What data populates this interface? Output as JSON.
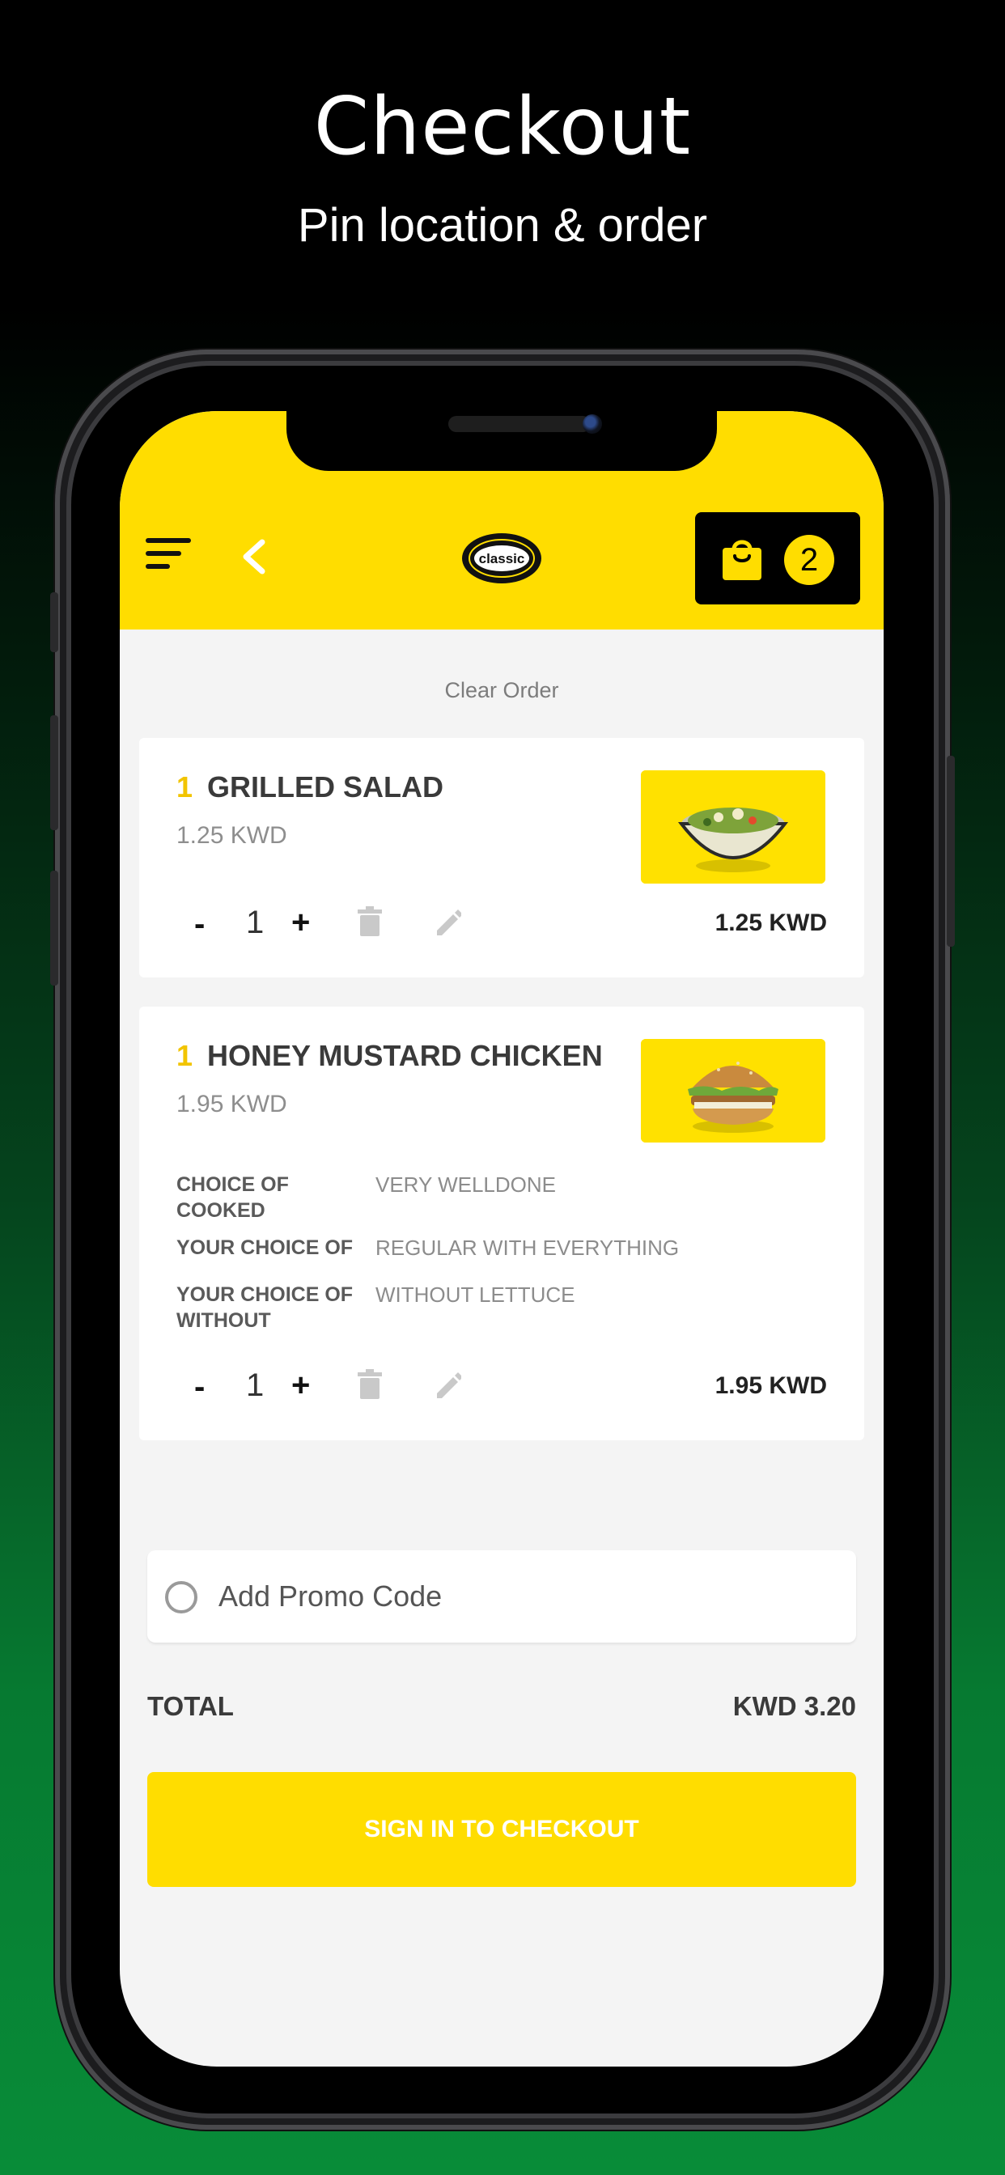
{
  "promo": {
    "title": "Checkout",
    "subtitle": "Pin location & order"
  },
  "header": {
    "menu_icon": "hamburger-menu-icon",
    "back_icon": "chevron-left-icon",
    "logo_text": "classic",
    "cart_icon": "shopping-bag-icon",
    "cart_count": "2",
    "accent_color": "#ffdd00"
  },
  "clear_order_label": "Clear Order",
  "items": [
    {
      "qty_badge": "1",
      "name": "GRILLED SALAD",
      "unit_price": "1.25 KWD",
      "stepper_minus": "-",
      "quantity": "1",
      "stepper_plus": "+",
      "line_total": "1.25 KWD",
      "image_alt": "salad-bowl",
      "options": []
    },
    {
      "qty_badge": "1",
      "name": "HONEY MUSTARD CHICKEN",
      "unit_price": "1.95 KWD",
      "stepper_minus": "-",
      "quantity": "1",
      "stepper_plus": "+",
      "line_total": "1.95 KWD",
      "image_alt": "chicken-burger",
      "options": [
        {
          "label": "CHOICE OF COOKED",
          "value": "VERY WELLDONE"
        },
        {
          "label": "YOUR CHOICE OF",
          "value": "REGULAR WITH EVERYTHING"
        },
        {
          "label": "YOUR CHOICE OF WITHOUT",
          "value": "WITHOUT LETTUCE"
        }
      ]
    }
  ],
  "promo_code": {
    "label": "Add Promo Code"
  },
  "total": {
    "label": "TOTAL",
    "value": "KWD 3.20"
  },
  "checkout_button": "SIGN IN TO CHECKOUT"
}
